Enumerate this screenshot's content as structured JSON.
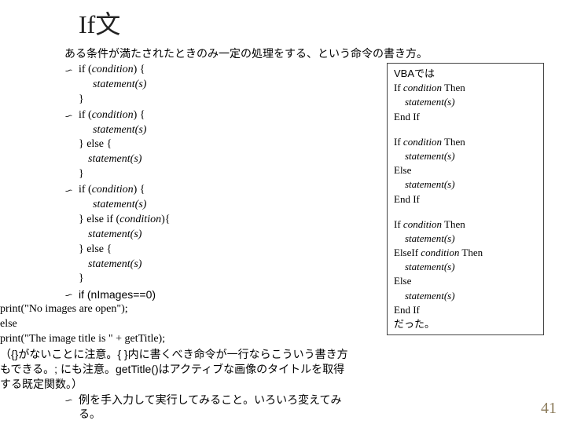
{
  "title": "If文",
  "subtitle": "ある条件が満たされたときのみ一定の処理をする、という命令の書き方。",
  "blocks": {
    "b1": {
      "l1a": "if (",
      "l1b": "condition",
      "l1c": ") {",
      "l2": "statement(s)",
      "l3": "}"
    },
    "b2": {
      "l1a": "if (",
      "l1b": "condition",
      "l1c": ") {",
      "l2": "statement(s)",
      "l3": "} else {",
      "l4": "statement(s)",
      "l5": "}"
    },
    "b3": {
      "l1a": "if (",
      "l1b": "condition",
      "l1c": ") {",
      "l2": "statement(s)",
      "l3a": "} else if (",
      "l3b": "condition",
      "l3c": "){",
      "l4": "statement(s)",
      "l5": "} else {",
      "l6": "statement(s)",
      "l7": "}"
    },
    "b4": {
      "l1": "if (nImages==0)",
      "l2": "print(\"No images are open\");",
      "l3": "else",
      "l4": "print(\"The image title is \" + getTitle);"
    }
  },
  "note": "（{}がないことに注意。{ }内に書くべき命令が一行ならこういう書き方もできる。; にも注意。getTitle()はアクティブな画像のタイトルを取得する既定関数。）",
  "footer": "例を手入力して実行してみること。いろいろ変えてみる。",
  "vba": {
    "head": "VBAでは",
    "p1": {
      "l1a": "If ",
      "l1b": "condition",
      "l1c": " Then",
      "l2": "statement(s)",
      "l3": "End If"
    },
    "p2": {
      "l1a": "If ",
      "l1b": "condition",
      "l1c": " Then",
      "l2": "statement(s)",
      "l3": "Else",
      "l4": "statement(s)",
      "l5": "End If"
    },
    "p3": {
      "l1a": "If ",
      "l1b": "condition",
      "l1c": " Then",
      "l2": "statement(s)",
      "l3a": "ElseIf ",
      "l3b": "condition",
      "l3c": " Then",
      "l4": "statement(s)",
      "l5": "Else",
      "l6": "statement(s)",
      "l7": "End If"
    },
    "tail": "だった。"
  },
  "page_no": "41"
}
